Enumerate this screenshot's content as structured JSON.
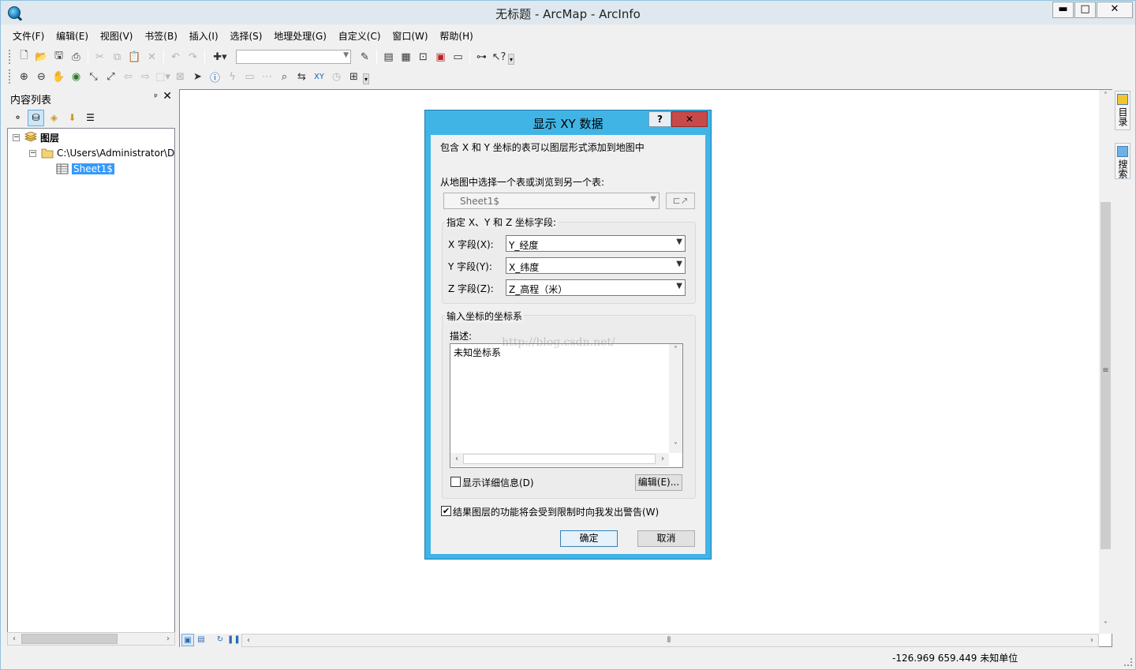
{
  "window": {
    "title": "无标题 - ArcMap - ArcInfo",
    "controls": {
      "minimize": "▬",
      "maximize": "□",
      "close": "✕"
    }
  },
  "menu": [
    "文件(F)",
    "编辑(E)",
    "视图(V)",
    "书签(B)",
    "插入(I)",
    "选择(S)",
    "地理处理(G)",
    "自定义(C)",
    "窗口(W)",
    "帮助(H)"
  ],
  "toc": {
    "title": "内容列表",
    "pin": "ᵖ",
    "close": "✕",
    "tree": {
      "root_label": "图层",
      "source_path": "C:\\Users\\Administrator\\D",
      "table_name": "Sheet1$"
    }
  },
  "side_tabs": [
    "目录",
    "搜索"
  ],
  "status": {
    "coordinates": "-126.969  659.449 未知单位"
  },
  "dialog": {
    "title": "显示 XY 数据",
    "help": "?",
    "close": "✕",
    "intro": "包含 X 和 Y 坐标的表可以图层形式添加到地图中",
    "choose_table_label": "从地图中选择一个表或浏览到另一个表:",
    "table_value": "Sheet1$",
    "fields_group_title": "指定 X、Y 和 Z 坐标字段:",
    "x_label": "X 字段(X):",
    "x_value": "Y_经度",
    "y_label": "Y 字段(Y):",
    "y_value": "X_纬度",
    "z_label": "Z 字段(Z):",
    "z_value": "Z_高程（米）",
    "cs_group_title": "输入坐标的坐标系",
    "description_label": "描述:",
    "description_value": "未知坐标系",
    "watermark": "http://blog.csdn.net/",
    "show_details_label": "显示详细信息(D)",
    "show_details_checked": false,
    "edit_button": "编辑(E)...",
    "warning_label": "结果图层的功能将会受到限制时向我发出警告(W)",
    "warning_checked": true,
    "ok_button": "确定",
    "cancel_button": "取消"
  },
  "colors": {
    "dialog_frame": "#41b4e6",
    "selection": "#3399ff",
    "close_button": "#c74a4a"
  }
}
